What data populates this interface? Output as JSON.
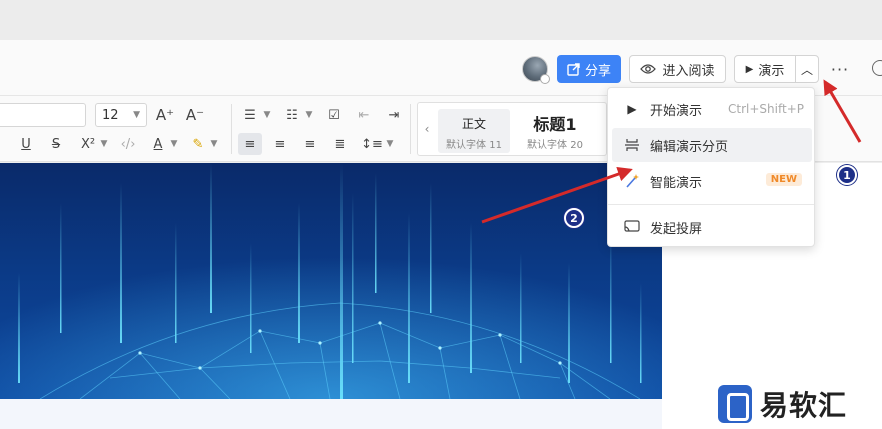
{
  "header": {
    "share_label": "分享",
    "read_label": "进入阅读",
    "present_label": "演示",
    "more_label": "···"
  },
  "toolbar": {
    "font_size": "12",
    "styles": [
      {
        "name": "正文",
        "sub": "默认字体 11"
      },
      {
        "name": "标题1",
        "sub": "默认字体 20"
      }
    ]
  },
  "dropdown": {
    "items": [
      {
        "label": "开始演示",
        "shortcut": "Ctrl+Shift+P",
        "icon": "play-icon"
      },
      {
        "label": "编辑演示分页",
        "icon": "page-break-icon"
      },
      {
        "label": "智能演示",
        "badge": "NEW",
        "icon": "magic-wand-icon"
      },
      {
        "label": "发起投屏",
        "icon": "screen-cast-icon"
      }
    ]
  },
  "annotations": {
    "marker_1": "1",
    "marker_2": "2",
    "arrow_color": "#d42a2a"
  },
  "watermark": {
    "text": "易软汇"
  },
  "colors": {
    "accent": "#3d83f6",
    "canvas": "#0b3a86"
  }
}
